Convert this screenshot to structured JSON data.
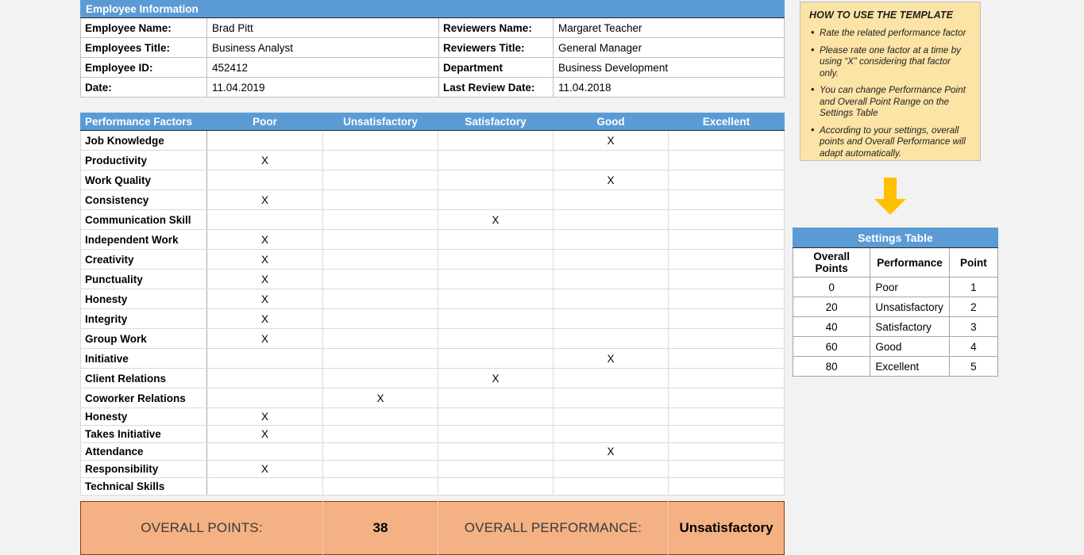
{
  "employee_info": {
    "header": "Employee Information",
    "rows": [
      {
        "left_label": "Employee Name:",
        "left_value": "Brad Pitt",
        "right_label": "Reviewers Name:",
        "right_value": "Margaret Teacher"
      },
      {
        "left_label": "Employees Title:",
        "left_value": "Business Analyst",
        "right_label": "Reviewers Title:",
        "right_value": "General Manager"
      },
      {
        "left_label": "Employee ID:",
        "left_value": "452412",
        "right_label": "Department",
        "right_value": "Business Development"
      },
      {
        "left_label": "Date:",
        "left_value": "11.04.2019",
        "right_label": "Last Review Date:",
        "right_value": "11.04.2018"
      }
    ]
  },
  "performance": {
    "columns": [
      "Performance Factors",
      "Poor",
      "Unsatisfactory",
      "Satisfactory",
      "Good",
      "Excellent"
    ],
    "mark": "X",
    "rows": [
      {
        "factor": "Job Knowledge",
        "rating": "Good"
      },
      {
        "factor": "Productivity",
        "rating": "Poor"
      },
      {
        "factor": "Work Quality",
        "rating": "Good"
      },
      {
        "factor": "Consistency",
        "rating": "Poor"
      },
      {
        "factor": "Communication Skill",
        "rating": "Satisfactory"
      },
      {
        "factor": "Independent Work",
        "rating": "Poor"
      },
      {
        "factor": "Creativity",
        "rating": "Poor"
      },
      {
        "factor": "Punctuality",
        "rating": "Poor"
      },
      {
        "factor": "Honesty",
        "rating": "Poor"
      },
      {
        "factor": "Integrity",
        "rating": "Poor"
      },
      {
        "factor": "Group Work",
        "rating": "Poor"
      },
      {
        "factor": "Initiative",
        "rating": "Good"
      },
      {
        "factor": "Client Relations",
        "rating": "Satisfactory"
      },
      {
        "factor": "Coworker Relations",
        "rating": "Unsatisfactory"
      },
      {
        "factor": "Honesty",
        "rating": "Poor"
      },
      {
        "factor": "Takes Initiative",
        "rating": "Poor"
      },
      {
        "factor": "Attendance",
        "rating": "Good"
      },
      {
        "factor": "Responsibility",
        "rating": "Poor"
      },
      {
        "factor": "Technical Skills",
        "rating": ""
      }
    ]
  },
  "overall": {
    "points_label": "OVERALL POINTS:",
    "points_value": "38",
    "performance_label": "OVERALL PERFORMANCE:",
    "performance_value": "Unsatisfactory"
  },
  "howto": {
    "title": "HOW TO USE THE TEMPLATE",
    "bullets": [
      "Rate the related performance factor",
      "Please rate one factor at a time by using “X” considering that factor only.",
      "You can change Performance Point and Overall Point Range on the Settings Table",
      "According to your settings, overall points and Overall Performance will adapt automatically."
    ]
  },
  "arrow": {
    "name": "down-arrow",
    "color": "#FFC000"
  },
  "settings_table": {
    "title": "Settings Table",
    "columns": [
      "Overall Points",
      "Performance",
      "Point"
    ],
    "rows": [
      {
        "overall_points": "0",
        "performance": "Poor",
        "point": "1"
      },
      {
        "overall_points": "20",
        "performance": "Unsatisfactory",
        "point": "2"
      },
      {
        "overall_points": "40",
        "performance": "Satisfactory",
        "point": "3"
      },
      {
        "overall_points": "60",
        "performance": "Good",
        "point": "4"
      },
      {
        "overall_points": "80",
        "performance": "Excellent",
        "point": "5"
      }
    ]
  },
  "colors": {
    "header_blue": "#5B9BD5",
    "summary_orange": "#F4B183",
    "howto_yellow": "#FCE4A6",
    "arrow_amber": "#FFC000",
    "page_background": "#F2F2F2"
  }
}
